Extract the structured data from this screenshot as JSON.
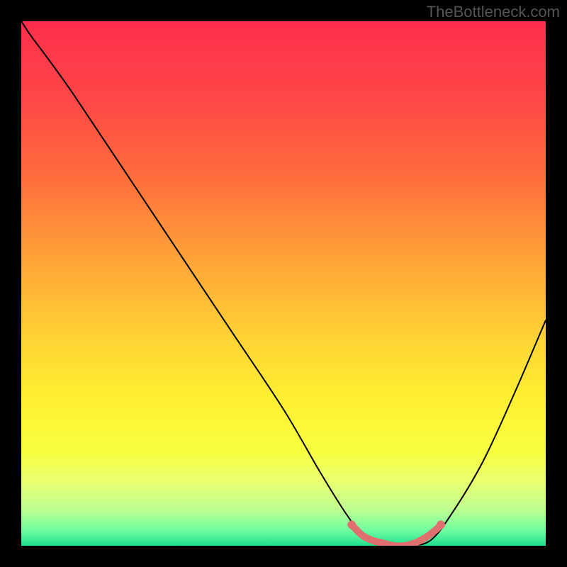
{
  "watermark": "TheBottleneck.com",
  "chart_data": {
    "type": "line",
    "title": "",
    "xlabel": "",
    "ylabel": "",
    "xlim": [
      0,
      100
    ],
    "ylim": [
      0,
      100
    ],
    "background": {
      "type": "vertical_gradient",
      "stops": [
        {
          "pos": 0.0,
          "color": "#FF2E4C"
        },
        {
          "pos": 0.15,
          "color": "#FF4747"
        },
        {
          "pos": 0.3,
          "color": "#FF6E3C"
        },
        {
          "pos": 0.45,
          "color": "#FFA238"
        },
        {
          "pos": 0.6,
          "color": "#FFD234"
        },
        {
          "pos": 0.72,
          "color": "#FFF030"
        },
        {
          "pos": 0.82,
          "color": "#F8FF40"
        },
        {
          "pos": 0.88,
          "color": "#E8FF70"
        },
        {
          "pos": 0.93,
          "color": "#C0FF90"
        },
        {
          "pos": 0.97,
          "color": "#70FFA0"
        },
        {
          "pos": 1.0,
          "color": "#20E090"
        }
      ]
    },
    "series": [
      {
        "name": "bottleneck-curve",
        "color": "#000000",
        "x": [
          0,
          2,
          5,
          10,
          20,
          30,
          40,
          50,
          57,
          62,
          66,
          70,
          74,
          78,
          82,
          88,
          94,
          100
        ],
        "y": [
          100,
          97,
          93,
          86,
          71,
          56,
          41,
          26,
          14,
          6,
          1,
          0,
          0,
          1,
          6,
          16,
          29,
          43
        ]
      }
    ],
    "highlight": {
      "name": "optimal-range",
      "color": "#E07070",
      "x_range": [
        63,
        80
      ],
      "x": [
        63,
        65,
        67,
        69,
        71,
        73,
        75,
        77,
        79,
        80
      ],
      "y": [
        4,
        2,
        1,
        0.5,
        0,
        0,
        0.5,
        1.5,
        3,
        4
      ]
    }
  }
}
